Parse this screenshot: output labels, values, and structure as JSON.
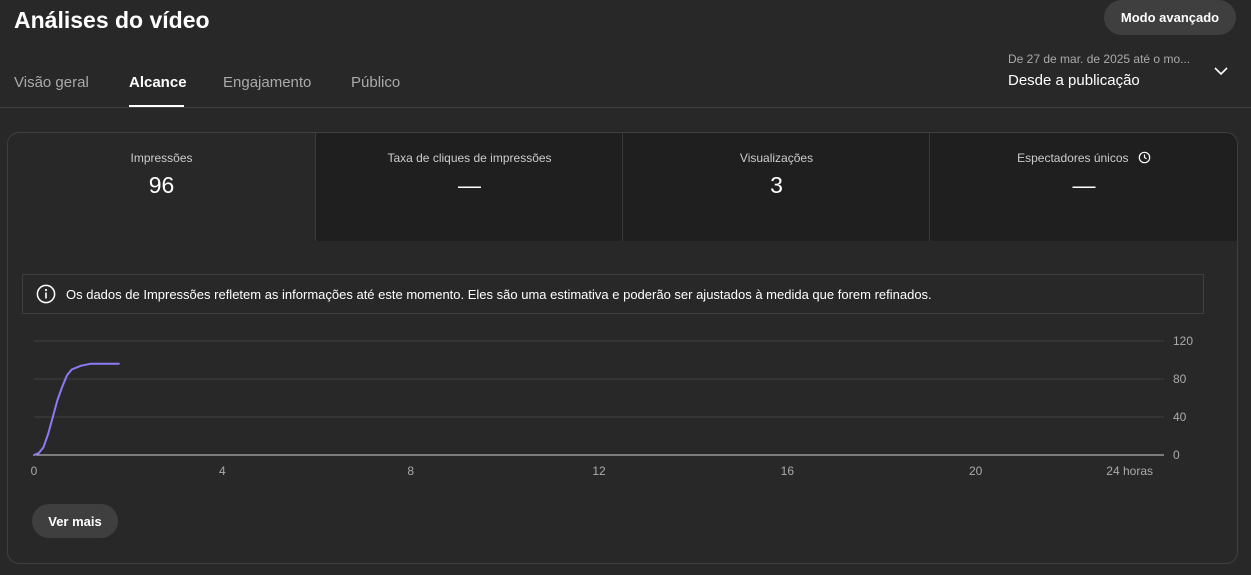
{
  "header": {
    "title": "Análises do vídeo",
    "advanced_mode_label": "Modo avançado"
  },
  "tabs": [
    {
      "label": "Visão geral",
      "active": false
    },
    {
      "label": "Alcance",
      "active": true
    },
    {
      "label": "Engajamento",
      "active": false
    },
    {
      "label": "Público",
      "active": false
    }
  ],
  "date_range": {
    "subtitle": "De 27 de mar. de 2025 até o mo...",
    "label": "Desde a publicação",
    "icon": "chevron-down-icon"
  },
  "metrics": [
    {
      "label": "Impressões",
      "value": "96",
      "active": true
    },
    {
      "label": "Taxa de cliques de impressões",
      "value": "—",
      "active": false
    },
    {
      "label": "Visualizações",
      "value": "3",
      "active": false
    },
    {
      "label": "Espectadores únicos",
      "value": "—",
      "active": false,
      "icon": "clock-icon"
    }
  ],
  "notice": {
    "icon": "info-icon",
    "text": "Os dados de Impressões refletem as informações até este momento. Eles são uma estimativa e poderão ser ajustados à medida que forem refinados."
  },
  "see_more_label": "Ver mais",
  "colors": {
    "background": "#282828",
    "line": "#8b7cf6",
    "grid": "#3f3f3f",
    "text_secondary": "#aaaaaa"
  },
  "chart_data": {
    "type": "line",
    "x_ticks": [
      "0",
      "4",
      "8",
      "12",
      "16",
      "20",
      "24 horas"
    ],
    "x_tick_values": [
      0,
      4,
      8,
      12,
      16,
      20,
      24
    ],
    "y_ticks": [
      "0",
      "40",
      "80",
      "120"
    ],
    "y_tick_values": [
      0,
      40,
      80,
      120
    ],
    "xlim": [
      0,
      24
    ],
    "ylim": [
      0,
      120
    ],
    "grid": true,
    "series": [
      {
        "x": [
          0,
          0.1,
          0.2,
          0.3,
          0.4,
          0.5,
          0.6,
          0.7,
          0.8,
          1.0,
          1.2,
          1.5,
          1.8
        ],
        "values": [
          0,
          2,
          8,
          22,
          40,
          58,
          72,
          84,
          90,
          94,
          96,
          96,
          96
        ]
      }
    ]
  }
}
